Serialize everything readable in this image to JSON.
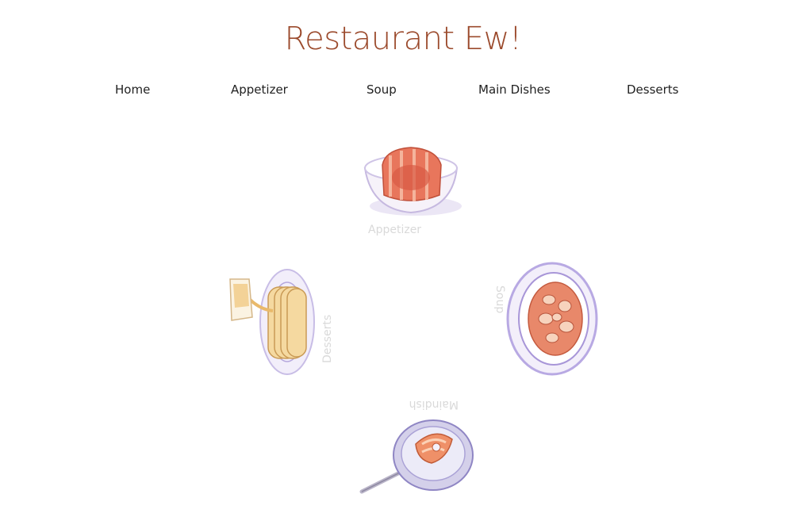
{
  "header": {
    "title": "Restaurant Ew!"
  },
  "nav": {
    "items": [
      {
        "label": "Home"
      },
      {
        "label": "Appetizer"
      },
      {
        "label": "Soup"
      },
      {
        "label": "Main Dishes"
      },
      {
        "label": "Desserts"
      }
    ]
  },
  "dishes": {
    "appetizer": {
      "label": "Appetizer",
      "icon": "appetizer-bowl-icon"
    },
    "soup": {
      "label": "Soup",
      "icon": "soup-plate-icon"
    },
    "maindish": {
      "label": "Maindish",
      "icon": "fish-pan-icon"
    },
    "desserts": {
      "label": "Desserts",
      "icon": "pancake-stack-icon"
    }
  },
  "colors": {
    "title": "#9b4a2c",
    "nav_text": "#222222",
    "dish_label": "#d9d9d9"
  }
}
